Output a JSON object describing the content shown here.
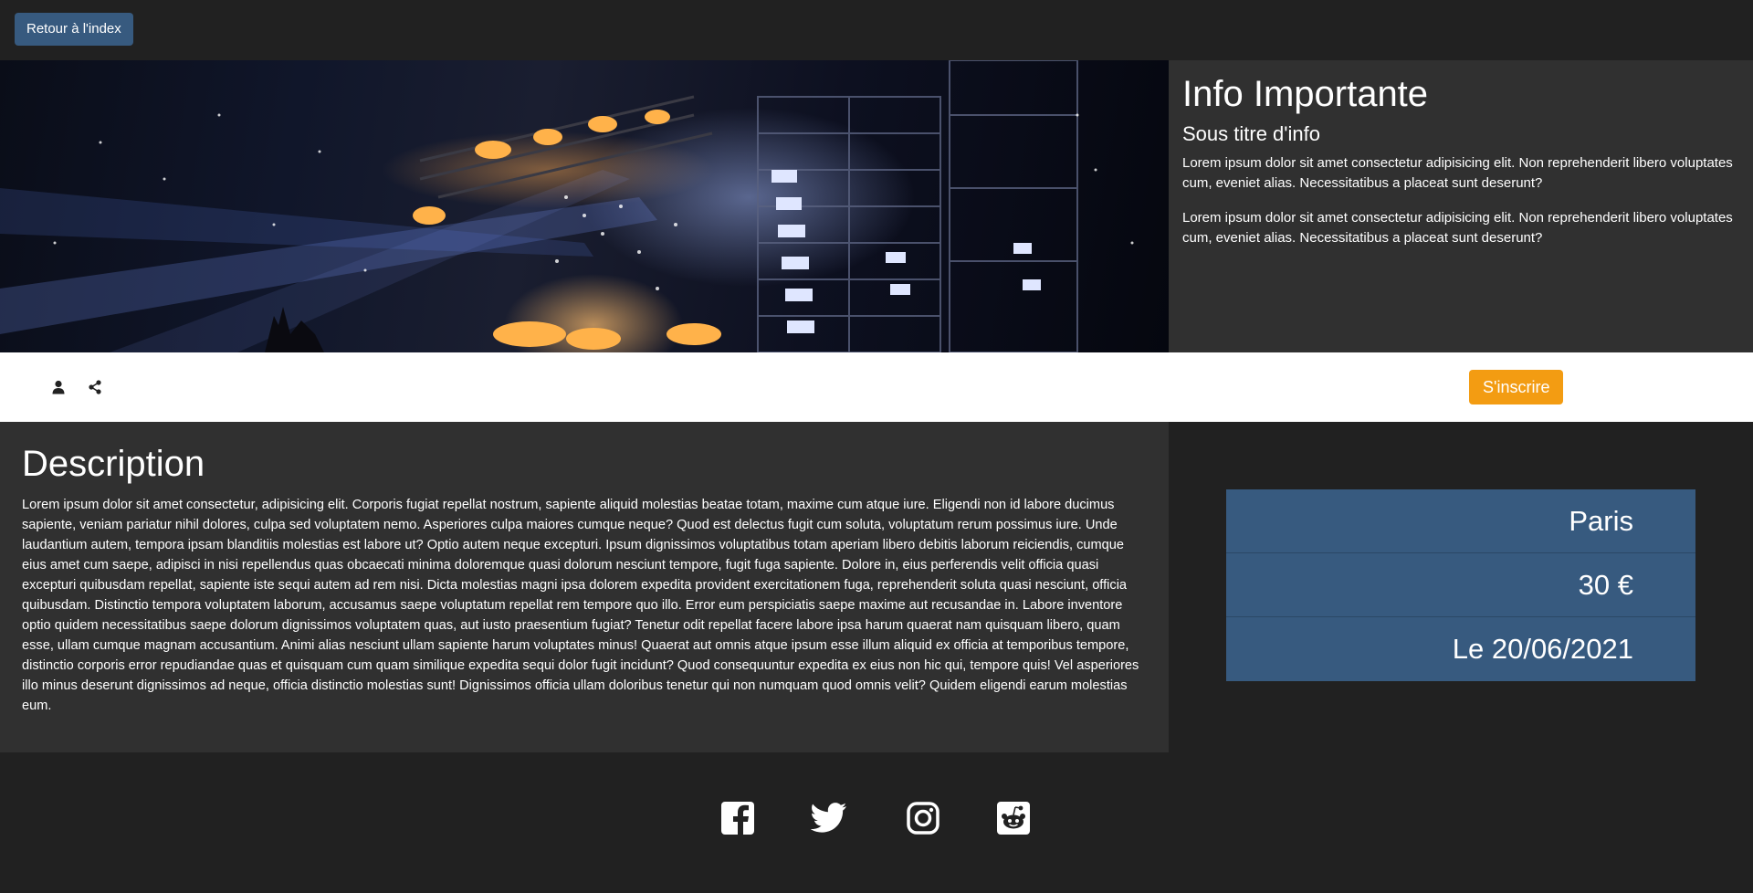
{
  "nav": {
    "back_label": "Retour à l'index"
  },
  "hero": {
    "image_alt": "Concert stage with lights and confetti"
  },
  "info": {
    "title": "Info Importante",
    "subtitle": "Sous titre d'info",
    "paragraphs": [
      "Lorem ipsum dolor sit amet consectetur adipisicing elit. Non reprehenderit libero voluptates cum, eveniet alias. Necessitatibus a placeat sunt deserunt?",
      "Lorem ipsum dolor sit amet consectetur adipisicing elit. Non reprehenderit libero voluptates cum, eveniet alias. Necessitatibus a placeat sunt deserunt?"
    ]
  },
  "actions": {
    "user_icon": "user-icon",
    "share_icon": "share-icon",
    "signup_label": "S'inscrire"
  },
  "description": {
    "title": "Description",
    "text": "Lorem ipsum dolor sit amet consectetur, adipisicing elit. Corporis fugiat repellat nostrum, sapiente aliquid molestias beatae totam, maxime cum atque iure. Eligendi non id labore ducimus sapiente, veniam pariatur nihil dolores, culpa sed voluptatem nemo. Asperiores culpa maiores cumque neque? Quod est delectus fugit cum soluta, voluptatum rerum possimus iure. Unde laudantium autem, tempora ipsam blanditiis molestias est labore ut? Optio autem neque excepturi. Ipsum dignissimos voluptatibus totam aperiam libero debitis laborum reiciendis, cumque eius amet cum saepe, adipisci in nisi repellendus quas obcaecati minima doloremque quasi dolorum nesciunt tempore, fugit fuga sapiente. Dolore in, eius perferendis velit officia quasi excepturi quibusdam repellat, sapiente iste sequi autem ad rem nisi. Dicta molestias magni ipsa dolorem expedita provident exercitationem fuga, reprehenderit soluta quasi nesciunt, officia quibusdam. Distinctio tempora voluptatem laborum, accusamus saepe voluptatum repellat rem tempore quo illo. Error eum perspiciatis saepe maxime aut recusandae in. Labore inventore optio quidem necessitatibus saepe dolorum dignissimos voluptatem quas, aut iusto praesentium fugiat? Tenetur odit repellat facere labore ipsa harum quaerat nam quisquam libero, quam esse, ullam cumque magnam accusantium. Animi alias nesciunt ullam sapiente harum voluptates minus! Quaerat aut omnis atque ipsum esse illum aliquid ex officia at temporibus tempore, distinctio corporis error repudiandae quas et quisquam cum quam similique expedita sequi dolor fugit incidunt? Quod consequuntur expedita ex eius non hic qui, tempore quis! Vel asperiores illo minus deserunt dignissimos ad neque, officia distinctio molestias sunt! Dignissimos officia ullam doloribus tenetur qui non numquam quod omnis velit? Quidem eligendi earum molestias eum."
  },
  "details": {
    "city": "Paris",
    "price": "30 €",
    "date": "Le 20/06/2021"
  },
  "footer": {
    "social": [
      "facebook-icon",
      "twitter-icon",
      "instagram-icon",
      "reddit-icon"
    ]
  },
  "colors": {
    "background": "#212121",
    "panel": "#303030",
    "primary": "#375a7f",
    "accent": "#f39c12"
  }
}
